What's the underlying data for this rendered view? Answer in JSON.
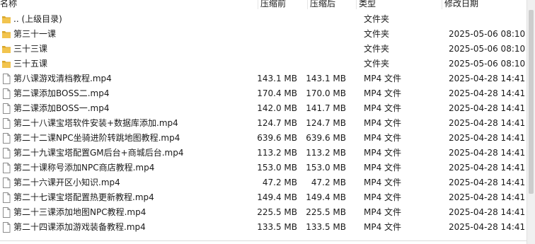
{
  "header": {
    "name": "名称",
    "compressed": "压缩前",
    "uncompressed": "压缩后",
    "type": "类型",
    "modified": "修改日期"
  },
  "colors": {
    "folder": "#f2c44e",
    "folder_dark": "#d9a62a",
    "file_border": "#8c8c8c"
  },
  "rows": [
    {
      "icon": "folder-icon",
      "name": ".. (上级目录)",
      "compressed": "",
      "uncompressed": "",
      "type": "文件夹",
      "modified": ""
    },
    {
      "icon": "folder-icon",
      "name": "第三十一课",
      "compressed": "",
      "uncompressed": "",
      "type": "文件夹",
      "modified": "2025-05-06 08:10"
    },
    {
      "icon": "folder-icon",
      "name": "三十三课",
      "compressed": "",
      "uncompressed": "",
      "type": "文件夹",
      "modified": "2025-05-06 08:10"
    },
    {
      "icon": "folder-icon",
      "name": "三十五课",
      "compressed": "",
      "uncompressed": "",
      "type": "文件夹",
      "modified": "2025-05-06 08:10"
    },
    {
      "icon": "file-icon",
      "name": "第八课游戏清档教程.mp4",
      "compressed": "143.1 MB",
      "uncompressed": "143.1 MB",
      "type": "MP4 文件",
      "modified": "2025-04-28 14:41"
    },
    {
      "icon": "file-icon",
      "name": "第二课添加BOSS二.mp4",
      "compressed": "170.4 MB",
      "uncompressed": "170.0 MB",
      "type": "MP4 文件",
      "modified": "2025-04-28 14:41"
    },
    {
      "icon": "file-icon",
      "name": "第二课添加BOSS一.mp4",
      "compressed": "142.0 MB",
      "uncompressed": "141.7 MB",
      "type": "MP4 文件",
      "modified": "2025-04-28 14:41"
    },
    {
      "icon": "file-icon",
      "name": "第二十八课宝塔软件安装+数据库添加.mp4",
      "compressed": "124.7 MB",
      "uncompressed": "124.7 MB",
      "type": "MP4 文件",
      "modified": "2025-04-28 14:41"
    },
    {
      "icon": "file-icon",
      "name": "第二十二课NPC坐骑进阶转跳地图教程.mp4",
      "compressed": "639.6 MB",
      "uncompressed": "639.6 MB",
      "type": "MP4 文件",
      "modified": "2025-04-28 14:41"
    },
    {
      "icon": "file-icon",
      "name": "第二十九课宝塔配置GM后台+商城后台.mp4",
      "compressed": "113.2 MB",
      "uncompressed": "113.2 MB",
      "type": "MP4 文件",
      "modified": "2025-04-28 14:41"
    },
    {
      "icon": "file-icon",
      "name": "第二十课称号添加NPC商店教程.mp4",
      "compressed": "153.0 MB",
      "uncompressed": "153.0 MB",
      "type": "MP4 文件",
      "modified": "2025-04-28 14:41"
    },
    {
      "icon": "file-icon",
      "name": "第二十六课开区小知识.mp4",
      "compressed": "47.2 MB",
      "uncompressed": "47.2 MB",
      "type": "MP4 文件",
      "modified": "2025-04-28 14:41"
    },
    {
      "icon": "file-icon",
      "name": "第二十七课宝塔配置热更新教程.mp4",
      "compressed": "149.4 MB",
      "uncompressed": "149.4 MB",
      "type": "MP4 文件",
      "modified": "2025-04-28 14:41"
    },
    {
      "icon": "file-icon",
      "name": "第二十三课添加地图NPC教程.mp4",
      "compressed": "225.5 MB",
      "uncompressed": "225.5 MB",
      "type": "MP4 文件",
      "modified": "2025-04-28 14:41"
    },
    {
      "icon": "file-icon",
      "name": "第二十四课添加游戏装备教程.mp4",
      "compressed": "133.5 MB",
      "uncompressed": "133.5 MB",
      "type": "MP4 文件",
      "modified": "2025-04-28 14:41"
    }
  ]
}
